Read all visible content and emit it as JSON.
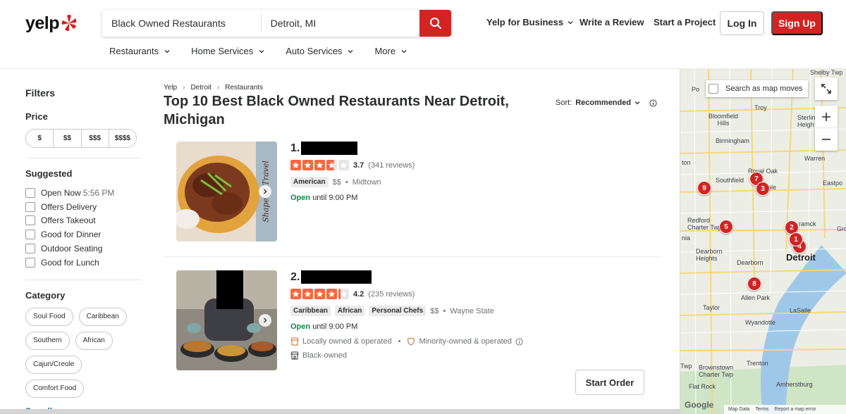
{
  "header": {
    "logo_text": "yelp",
    "search_what": "Black Owned Restaurants",
    "search_where": "Detroit, MI",
    "links": {
      "business": "Yelp for Business",
      "review": "Write a Review",
      "project": "Start a Project"
    },
    "login": "Log In",
    "signup": "Sign Up",
    "categories": [
      "Restaurants",
      "Home Services",
      "Auto Services",
      "More"
    ]
  },
  "filters": {
    "title": "Filters",
    "price_title": "Price",
    "prices": [
      "$",
      "$$",
      "$$$",
      "$$$$"
    ],
    "suggested_title": "Suggested",
    "open_now": "Open Now",
    "open_now_time": "5:56 PM",
    "suggested": [
      "Offers Delivery",
      "Offers Takeout",
      "Good for Dinner",
      "Outdoor Seating",
      "Good for Lunch"
    ],
    "category_title": "Category",
    "categories": [
      "Soul Food",
      "Caribbean",
      "Southern",
      "African",
      "Cajun/Creole",
      "Comfort Food"
    ],
    "see_all": "See all"
  },
  "main": {
    "breadcrumb": [
      "Yelp",
      "Detroit",
      "Restaurants"
    ],
    "title": "Top 10 Best Black Owned Restaurants Near Detroit, Michigan",
    "sort_label": "Sort:",
    "sort_value": "Recommended",
    "results": [
      {
        "rank": "1.",
        "rating": 3.7,
        "rating_text": "3.7",
        "reviews": "(341 reviews)",
        "tags": [
          "American"
        ],
        "price": "$$",
        "area": "Midtown",
        "open": "Open",
        "until": "until 9:00 PM",
        "image_caption": "Shape of Travel"
      },
      {
        "rank": "2.",
        "rating": 4.2,
        "rating_text": "4.2",
        "reviews": "(235 reviews)",
        "tags": [
          "Caribbean",
          "African",
          "Personal Chefs"
        ],
        "price": "$$",
        "area": "Wayne State",
        "open": "Open",
        "until": "until 9:00 PM",
        "amenity_1": "Locally owned & operated",
        "amenity_2": "Minority-owned & operated",
        "amenity_3": "Black-owned",
        "order_button": "Start Order"
      }
    ]
  },
  "map": {
    "search_as_moves": "Search as map moves",
    "labels": {
      "shelby": "Shelby Twp",
      "troy": "Troy",
      "bloomfield": "Bloomfield Hills",
      "sterling": "Sterlin Heigh",
      "birmingham": "Birmingham",
      "warren": "Warren",
      "royal_oak": "Royal Oak",
      "southfield": "Southfield",
      "ferndale": "ale",
      "eastpointe": "Eastpo",
      "redford": "Redford Charter Twp",
      "hamtramck": "ramck",
      "dearborn_heights": "Dearborn Heights",
      "dearborn": "Dearborn",
      "detroit": "Detroit",
      "allen_park": "Allen Park",
      "taylor": "Taylor",
      "lasalle": "LaSalle",
      "wyandotte": "Wyandotte",
      "trenton": "Trenton",
      "brownstown": "Brownstown Charter Twp",
      "amherstburg": "Amherstburg",
      "flat_rock": "Flat Rock",
      "pontiac_edge": "Po",
      "ton_edge": "ton",
      "nia_edge": "nia",
      "gro_edge": "Gro",
      "twp_edge": "Twp"
    },
    "pins": [
      "1",
      "2",
      "3",
      "4",
      "5",
      "7",
      "8",
      "9"
    ],
    "footer": [
      "Map Data",
      "Terms",
      "Report a map error"
    ],
    "google": "Google"
  },
  "colors": {
    "brand": "#d32323",
    "star_full": "#ff643d",
    "star_empty": "#e6e6e6",
    "open_green": "#0b8b48",
    "link_teal": "#027a97"
  }
}
